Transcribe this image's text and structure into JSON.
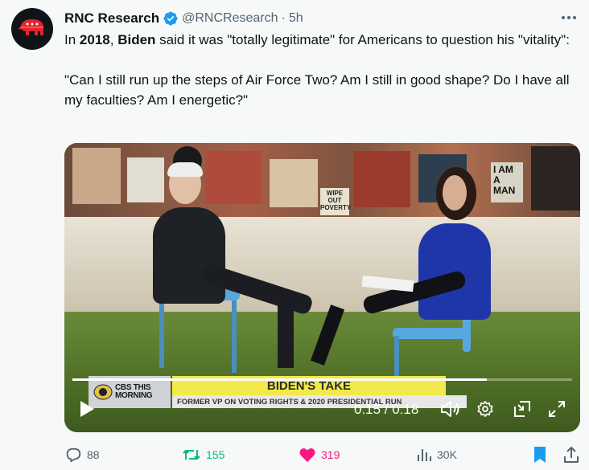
{
  "author": {
    "name": "RNC Research",
    "handle": "@RNCResearch",
    "separator": "·",
    "time": "5h"
  },
  "tweet": {
    "para1_prefix": "In ",
    "para1_year": "2018",
    "para1_comma": ", ",
    "para1_name": "Biden",
    "para1_rest": " said it was \"totally legitimate\" for Americans to question his \"vitality\":",
    "para2": "\"Can I still run up the steps of Air Force Two? Am I still in good shape? Do I have all my faculties? Am I energetic?\""
  },
  "video": {
    "wall_signs": [
      "WIPE OUT POVERTY",
      "I AM A MAN"
    ],
    "network_line1": "CBS THIS",
    "network_line2": "MORNING",
    "headline": "BIDEN'S TAKE",
    "subheadline": "FORMER VP ON VOTING RIGHTS & 2020 PRESIDENTIAL RUN",
    "timecode": "0:15 / 0:18",
    "progress": 0.83
  },
  "actions": {
    "replies": "88",
    "reposts": "155",
    "likes": "319",
    "views": "30K"
  },
  "colors": {
    "verified": "#1d9bf0",
    "repost": "#00ba7c",
    "like": "#f91880",
    "bookmark": "#1d9bf0",
    "muted": "#536471"
  }
}
